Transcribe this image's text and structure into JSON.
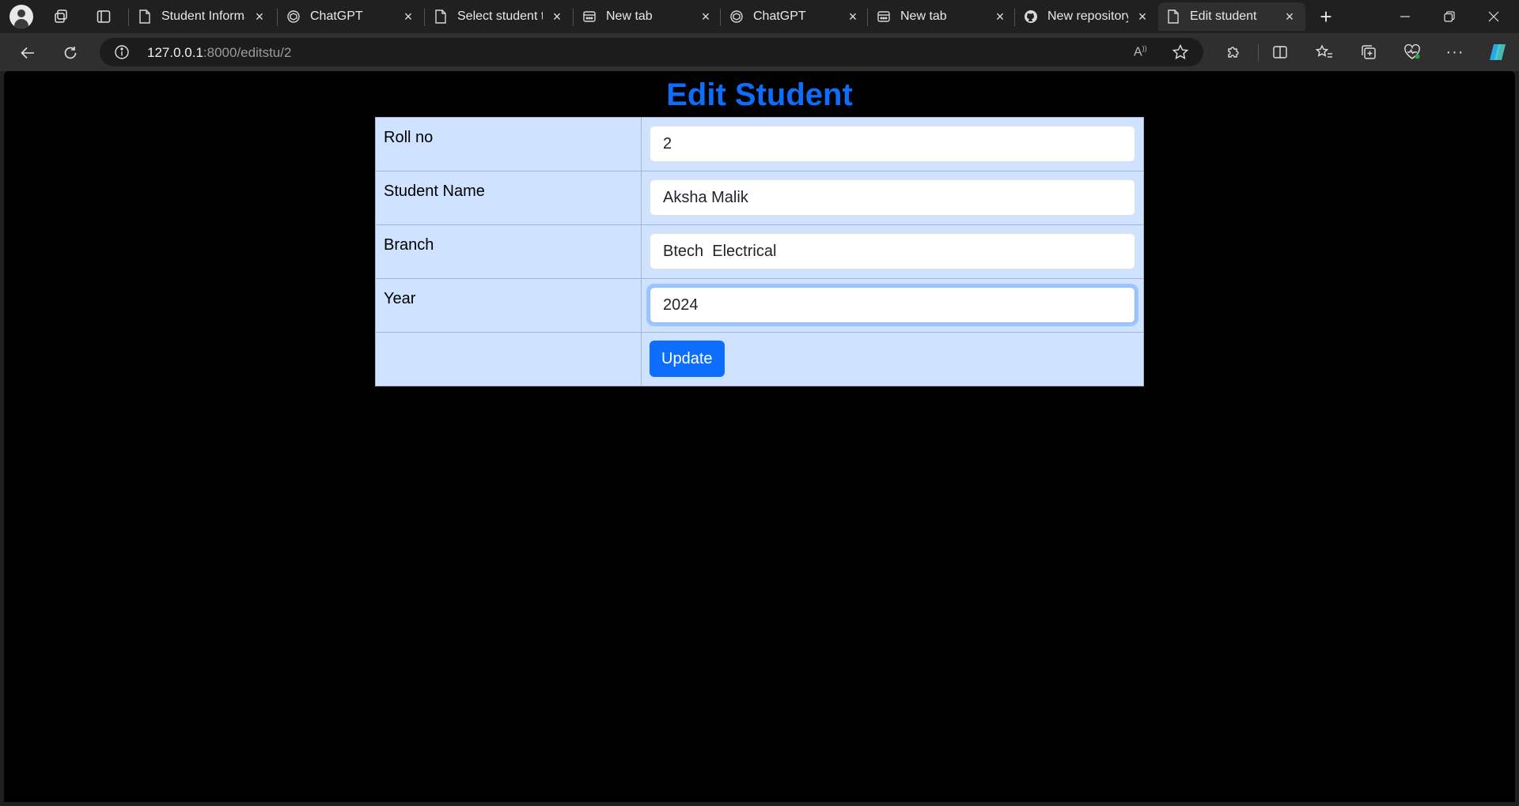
{
  "browser": {
    "tabs": [
      {
        "title": "Student Informat",
        "icon": "page-icon"
      },
      {
        "title": "ChatGPT",
        "icon": "chatgpt-icon"
      },
      {
        "title": "Select student to",
        "icon": "page-icon"
      },
      {
        "title": "New tab",
        "icon": "newtab-icon"
      },
      {
        "title": "ChatGPT",
        "icon": "chatgpt-icon"
      },
      {
        "title": "New tab",
        "icon": "newtab-icon"
      },
      {
        "title": "New repository",
        "icon": "github-icon"
      },
      {
        "title": "Edit student",
        "icon": "page-icon",
        "active": true
      }
    ],
    "address": {
      "host": "127.0.0.1",
      "rest": ":8000/editstu/2"
    },
    "read_aloud_glyph": "A",
    "new_tab_glyph": "+",
    "close_glyph": "×",
    "more_glyph": "···"
  },
  "page": {
    "heading": "Edit Student",
    "heading_color": "#0d6efd",
    "table_bg": "#cfe2ff",
    "fields": [
      {
        "label": "Roll no",
        "value": "2"
      },
      {
        "label": "Student Name",
        "value": "Aksha Malik"
      },
      {
        "label": "Branch",
        "value": "Btech  Electrical"
      },
      {
        "label": "Year",
        "value": "2024"
      }
    ],
    "submit_label": "Update"
  }
}
